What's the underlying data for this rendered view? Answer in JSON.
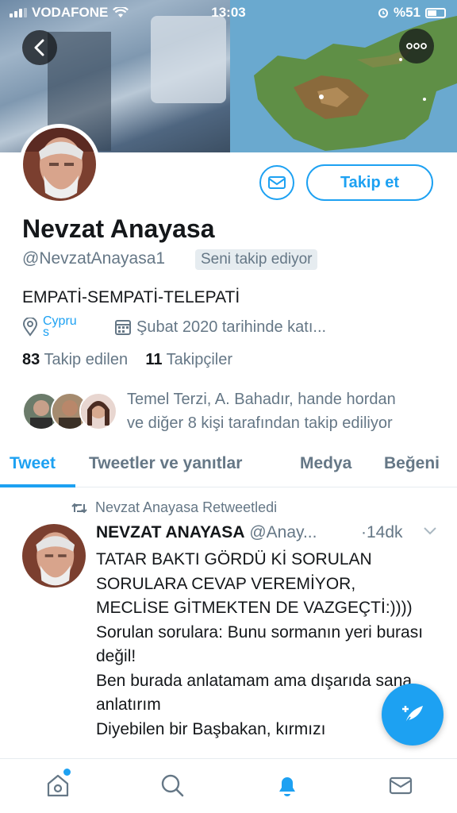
{
  "status_bar": {
    "carrier": "VODAFONE",
    "time": "13:03",
    "battery": "%51"
  },
  "profile": {
    "name": "Nevzat Anayasa",
    "handle": "@NevzatAnayasa1",
    "follows_you": "Seni takip ediyor",
    "follow_label": "Takip et",
    "bio": "EMPATİ-SEMPATİ-TELEPATİ",
    "location": "Cypru",
    "location_line2": "s",
    "joined": "Şubat 2020 tarihinde katı...",
    "following_count": "83",
    "following_label": "Takip edilen",
    "followers_count": "11",
    "followers_label": "Takipçiler",
    "followed_by_line1": "Temel Terzi, A. Bahadır, hande hordan",
    "followed_by_line2": "ve diğer 8 kişi tarafından takip ediliyor"
  },
  "tabs": [
    {
      "label": "Tweet",
      "active": true
    },
    {
      "label": "Tweetler ve yanıtlar",
      "active": false
    },
    {
      "label": "Medya",
      "active": false
    },
    {
      "label": "Beğeni",
      "active": false
    }
  ],
  "tweet": {
    "retweet_label": "Nevzat Anayasa Retweetledi",
    "author_name": "NEVZAT ANAYASA",
    "author_handle": "@Anay...",
    "time": "·14dk",
    "text": "TATAR BAKTI GÖRDÜ Kİ SORULAN SORULARA CEVAP VEREMİYOR, MECLİSE GİTMEKTEN DE VAZGEÇTİ:))))\nSorulan sorulara: Bunu sormanın yeri burası değil!\nBen burada anlatamam ama dışarıda sana anlatırım\nDiyebilen bir Başbakan, kırmızı"
  },
  "icons": {
    "back": "chevron-left-icon",
    "more": "more-dots-icon",
    "mail": "envelope-icon",
    "location": "location-pin-icon",
    "calendar": "calendar-icon",
    "retweet": "retweet-icon",
    "chevron": "chevron-down-icon",
    "compose": "compose-feather-icon",
    "home": "home-icon",
    "search": "search-icon",
    "notifications": "bell-icon",
    "messages": "envelope-icon"
  },
  "colors": {
    "accent": "#1da1f2",
    "text": "#14171a",
    "secondary": "#657786"
  }
}
